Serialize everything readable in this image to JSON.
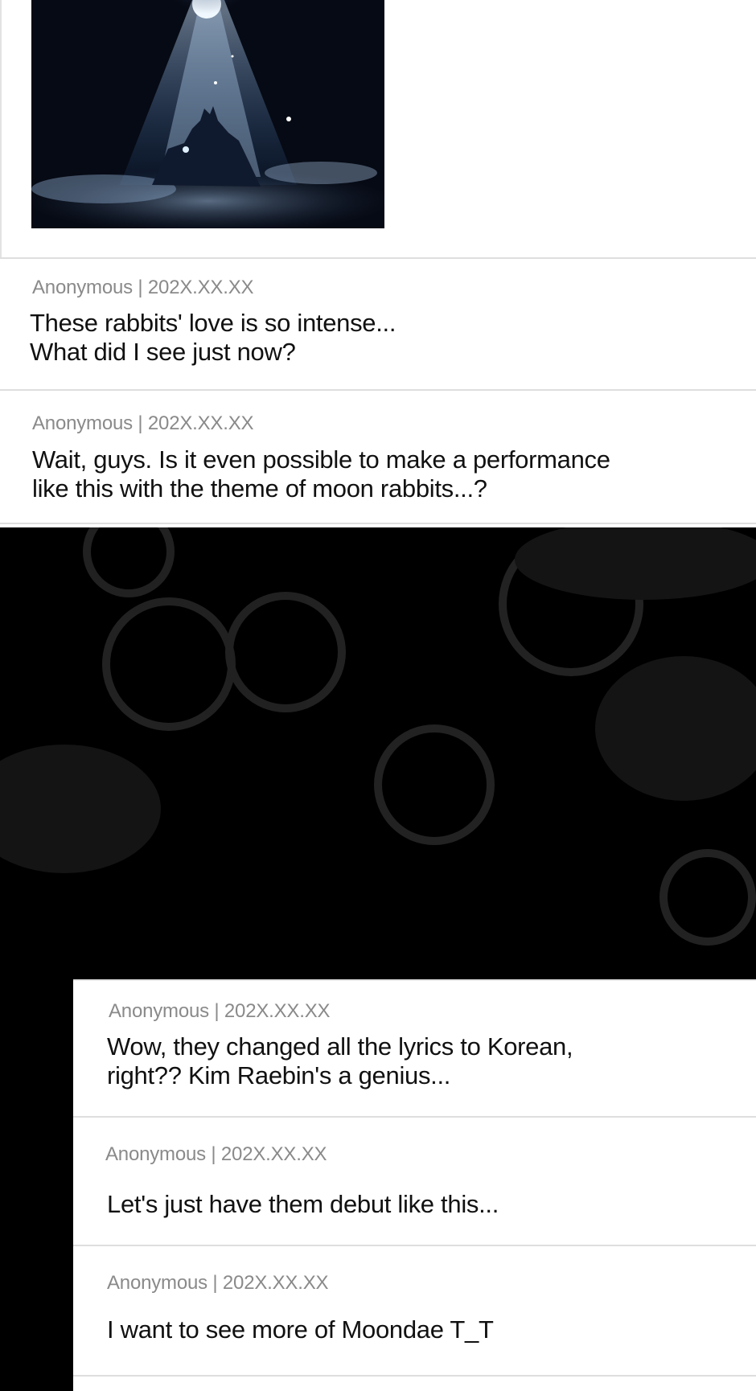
{
  "image": {
    "alt_icon": "moon-rabbit-silhouette-image"
  },
  "comments": [
    {
      "meta": "Anonymous | 202X.XX.XX",
      "text": "These rabbits' love is so intense...\nWhat did I see just now?"
    },
    {
      "meta": "Anonymous | 202X.XX.XX",
      "text": "Wait, guys. Is it even possible to make a performance\nlike this with the theme of moon rabbits...?"
    },
    {
      "meta": "Anonymous | 202X.XX.XX",
      "text": "Wow, they changed all the lyrics to Korean,\nright?? Kim Raebin's a genius..."
    },
    {
      "meta": "Anonymous | 202X.XX.XX",
      "text": "Let's just have them debut like this..."
    },
    {
      "meta": "Anonymous | 202X.XX.XX",
      "text": "I want to see more of Moondae T_T"
    }
  ],
  "colors": {
    "meta": "#8a8a8a",
    "text": "#111111",
    "divider": "#dedede",
    "dark": "#000000"
  }
}
